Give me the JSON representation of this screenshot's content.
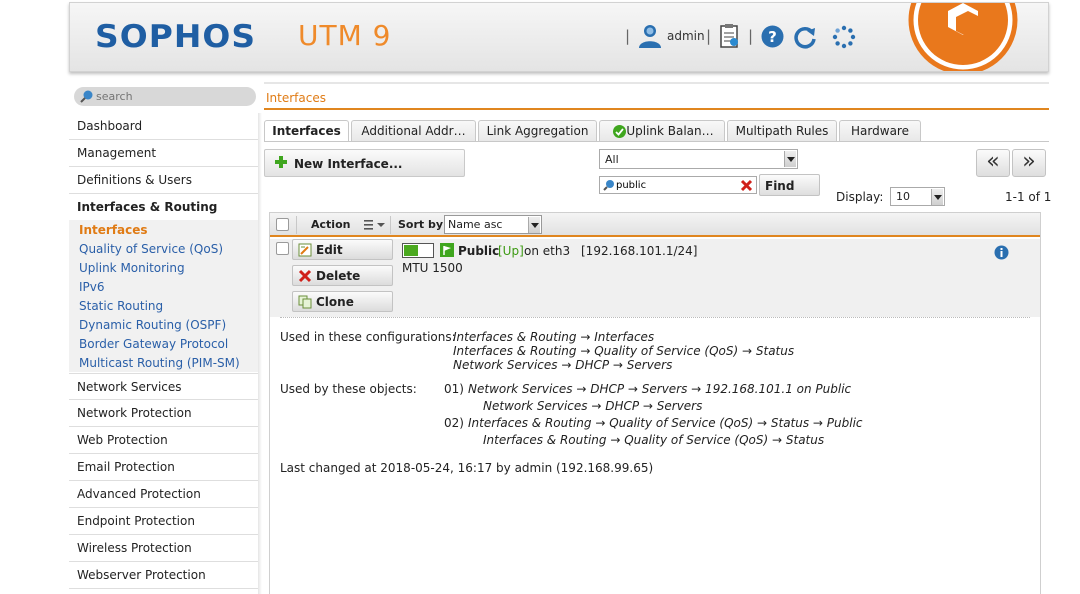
{
  "header": {
    "logo": "SOPHOS",
    "product": "UTM 9",
    "separator": "|",
    "user": "admin"
  },
  "search": {
    "placeholder": "search"
  },
  "breadcrumb": "Interfaces",
  "sidebar": {
    "items": [
      {
        "label": "Dashboard"
      },
      {
        "label": "Management"
      },
      {
        "label": "Definitions & Users"
      },
      {
        "label": "Interfaces & Routing"
      },
      {
        "label": "Network Services"
      },
      {
        "label": "Network Protection"
      },
      {
        "label": "Web Protection"
      },
      {
        "label": "Email Protection"
      },
      {
        "label": "Advanced Protection"
      },
      {
        "label": "Endpoint Protection"
      },
      {
        "label": "Wireless Protection"
      },
      {
        "label": "Webserver Protection"
      }
    ],
    "subitems": [
      {
        "label": "Interfaces"
      },
      {
        "label": "Quality of Service (QoS)"
      },
      {
        "label": "Uplink Monitoring"
      },
      {
        "label": "IPv6"
      },
      {
        "label": "Static Routing"
      },
      {
        "label": "Dynamic Routing (OSPF)"
      },
      {
        "label": "Border Gateway Protocol"
      },
      {
        "label": "Multicast Routing (PIM-SM)"
      }
    ]
  },
  "tabs": [
    {
      "label": "Interfaces"
    },
    {
      "label": "Additional Addr…"
    },
    {
      "label": "Link Aggregation"
    },
    {
      "label": "Uplink Balan…"
    },
    {
      "label": "Multipath Rules"
    },
    {
      "label": "Hardware"
    }
  ],
  "toolbar": {
    "new_label": "New Interface...",
    "filter_value": "All",
    "search_value": "public",
    "find_label": "Find",
    "prev": "«",
    "next": "»",
    "display_label": "Display:",
    "display_value": "10",
    "page_count": "1-1 of 1"
  },
  "list": {
    "action_header": "Action",
    "sort_label": "Sort by:",
    "sort_value": "Name asc",
    "row": {
      "edit": "Edit",
      "delete": "Delete",
      "clone": "Clone",
      "name": "Public",
      "state": "[Up]",
      "on": "on eth3",
      "address": "[192.168.101.1/24]",
      "mtu": "MTU 1500"
    },
    "details": {
      "configs_label": "Used in these configurations:",
      "configs": [
        "Interfaces & Routing → Interfaces",
        "Interfaces & Routing → Quality of Service (QoS) → Status",
        "Network Services → DHCP → Servers"
      ],
      "objects_label": "Used by these objects:",
      "objects": [
        {
          "num": "01)",
          "name": "Network Services → DHCP → Servers → 192.168.101.1 on Public",
          "path": "Network Services → DHCP → Servers"
        },
        {
          "num": "02)",
          "name": "Interfaces & Routing → Quality of Service (QoS) → Status → Public",
          "path": "Interfaces & Routing → Quality of Service (QoS) → Status"
        }
      ],
      "last_changed": "Last changed at 2018-05-24, 16:17 by admin (192.168.99.65)"
    }
  },
  "colors": {
    "brand_blue": "#1f5ea3",
    "accent_orange": "#e07b14",
    "status_green": "#4ba91f"
  }
}
